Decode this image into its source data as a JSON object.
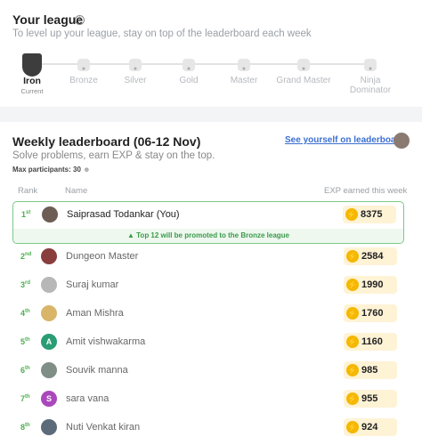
{
  "league": {
    "title": "Your league",
    "subtitle": "To level up your league, stay on top of the leaderboard each week",
    "tiers": [
      {
        "name": "Iron",
        "sub": "Current"
      },
      {
        "name": "Bronze"
      },
      {
        "name": "Silver"
      },
      {
        "name": "Gold"
      },
      {
        "name": "Master"
      },
      {
        "name": "Grand Master"
      },
      {
        "name": "Ninja Dominator"
      }
    ],
    "icons": [
      "info-icon",
      "iron-shield-icon",
      "lock-icon"
    ]
  },
  "board": {
    "title": "Weekly leaderboard (06-12 Nov)",
    "subtitle": "Solve problems, earn EXP & stay on the top.",
    "max_participants": "Max participants: 30",
    "see_link": "See yourself on leaderboard",
    "col_rank": "Rank",
    "col_name": "Name",
    "col_exp": "EXP earned this week",
    "promo": "Top 12 will be promoted to the Bronze league",
    "rows": [
      {
        "rank": "1",
        "sfx": "st",
        "name": "Saiprasad Todankar (You)",
        "exp": "8375"
      },
      {
        "rank": "2",
        "sfx": "nd",
        "name": "Dungeon Master",
        "exp": "2584"
      },
      {
        "rank": "3",
        "sfx": "rd",
        "name": "Suraj kumar",
        "exp": "1990"
      },
      {
        "rank": "4",
        "sfx": "th",
        "name": "Aman Mishra",
        "exp": "1760"
      },
      {
        "rank": "5",
        "sfx": "th",
        "name": "Amit vishwakarma",
        "exp": "1160",
        "initial": "A"
      },
      {
        "rank": "6",
        "sfx": "th",
        "name": "Souvik manna",
        "exp": "985"
      },
      {
        "rank": "7",
        "sfx": "th",
        "name": "sara vana",
        "exp": "955",
        "initial": "S"
      },
      {
        "rank": "8",
        "sfx": "th",
        "name": "Nuti Venkat kiran",
        "exp": "924"
      }
    ]
  },
  "colors": {
    "accent_green": "#4caf50",
    "link_blue": "#3b6fd1",
    "exp_gold": "#f5b700"
  }
}
